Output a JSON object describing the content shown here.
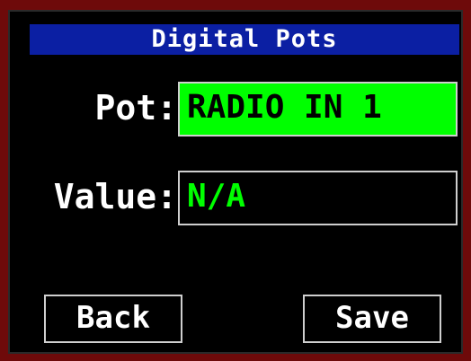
{
  "screen": {
    "title": "Digital Pots",
    "pot": {
      "label": "Pot:",
      "value": "RADIO IN 1"
    },
    "value": {
      "label": "Value:",
      "value": "N/A"
    },
    "buttons": {
      "back": "Back",
      "save": "Save"
    }
  },
  "colors": {
    "frame": "#6e0a0a",
    "background": "#000000",
    "title_bar": "#0b1fa3",
    "pot_field_bg": "#00ff00",
    "value_text": "#00ff00",
    "text": "#ffffff"
  }
}
